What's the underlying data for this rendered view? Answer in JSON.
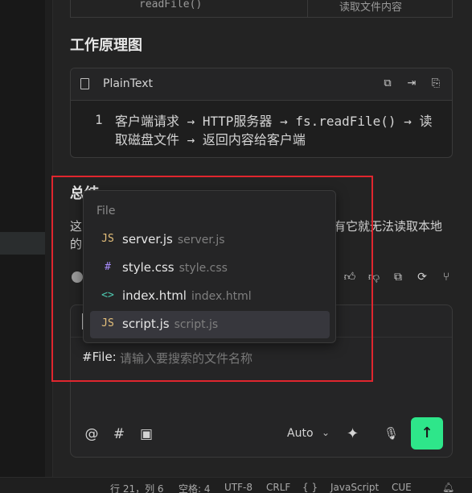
{
  "table": {
    "cell1": "readFile()",
    "cell2": "读取文件内容"
  },
  "principle_heading": "工作原理图",
  "code_block": {
    "language": "PlainText",
    "actions": [
      "copy-icon",
      "insert-icon",
      "new-file-icon"
    ],
    "line_number": "1",
    "line_text": "客户端请求 → HTTP服务器 → fs.readFile() → 读取磁盘文件 → 返回内容给客户端"
  },
  "summary_heading": "总结",
  "summary_text": {
    "left_line1": "这",
    "left_line2": "的",
    "right_fragment": "有它就无法读取本地"
  },
  "message_actions": [
    "thumbs-up-icon",
    "thumbs-down-icon",
    "copy-icon",
    "retry-icon",
    "branch-icon"
  ],
  "file_popup": {
    "header": "File",
    "items": [
      {
        "icon": "JS",
        "name": "server.js",
        "path": "server.js",
        "icon_color": "#e5c07b"
      },
      {
        "icon": "#",
        "name": "style.css",
        "path": "style.css",
        "icon_color": "#a78bfa"
      },
      {
        "icon": "<>",
        "name": "index.html",
        "path": "index.html",
        "icon_color": "#4ec9b0"
      },
      {
        "icon": "JS",
        "name": "script.js",
        "path": "script.js",
        "icon_color": "#e5c07b"
      }
    ],
    "active_index": 3
  },
  "chat_input": {
    "typed": "#File:",
    "placeholder": "请输入要搜索的文件名称",
    "tools": [
      "@",
      "#",
      "image-icon"
    ],
    "mode": "Auto",
    "accent": "#2ee68a"
  },
  "status_bar": {
    "position": "行 21，列 6",
    "spaces": "空格: 4",
    "encoding": "UTF-8",
    "eol": "CRLF",
    "braces": "{ }",
    "language": "JavaScript",
    "extra": "CUE"
  }
}
